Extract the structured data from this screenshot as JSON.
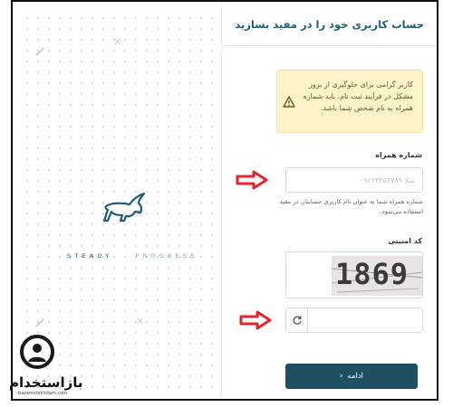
{
  "brand": {
    "word1": "STEADY",
    "word2": "PROGRESS"
  },
  "form": {
    "title": "حساب کاربری خود را در مفید بسازید",
    "alert_text": "کاربر گرامی برای جلوگیری از بروز مشکل در فرآیند ثبت نام، باید شماره همراه به نام شخص شما باشد.",
    "phone_label": "شماره همراه",
    "phone_placeholder": "مثلا ۰۹۱۲۳۴۵۶۷۸۹",
    "phone_help": "شماره همراه شما به عنوان نام کاربری حسابتان در مفید استفاده می‌شود.",
    "captcha_label": "کد امنیتی",
    "captcha_code": "1869",
    "submit_label": "ادامه"
  },
  "watermark": {
    "name": "بازاستخدام",
    "site": "bazarestekhdam.com"
  },
  "colors": {
    "accent": "#1e4f63",
    "title": "#1f5d74",
    "alert_bg": "#fdf3c8",
    "arrow": "#e3262f"
  }
}
